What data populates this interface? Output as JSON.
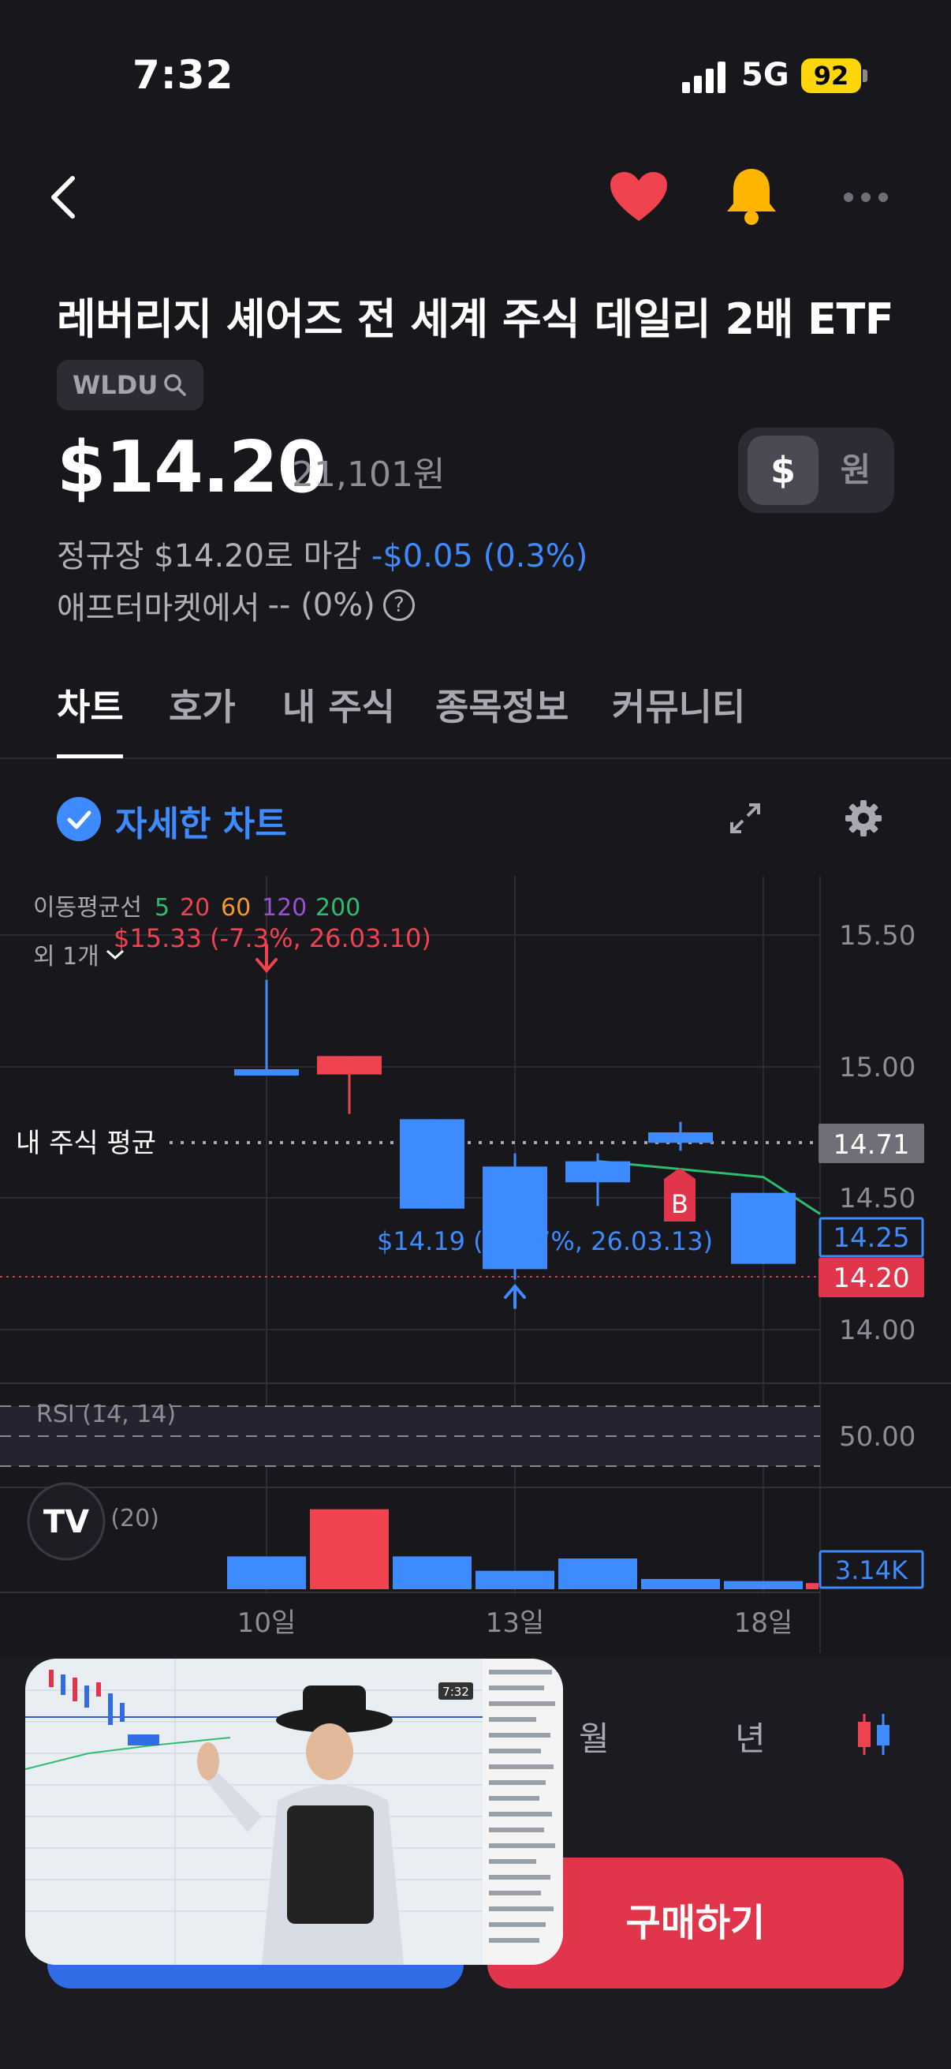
{
  "status_bar": {
    "time": "7:32",
    "network": "5G",
    "battery": "92"
  },
  "header": {
    "title": "레버리지 셰어즈 전 세계 주식 데일리 2배 ETF",
    "ticker": "WLDU"
  },
  "price": {
    "usd": "$14.20",
    "krw": "21,101원",
    "currency_usd": "$",
    "currency_krw": "원",
    "close_prefix": "정규장 $14.20로 마감",
    "close_change": "-$0.05 (0.3%)",
    "after_prefix": "애프터마켓에서",
    "after_change": "-- (0%)",
    "help_icon": "?"
  },
  "tabs": [
    "차트",
    "호가",
    "내 주식",
    "종목정보",
    "커뮤니티"
  ],
  "chart_toolbar": {
    "detail_label": "자세한 차트"
  },
  "chart_labels": {
    "ma_label": "이동평균선",
    "ma_periods": [
      "5",
      "20",
      "60",
      "120",
      "200"
    ],
    "ma_colors": [
      "#2dbd6e",
      "#f0424f",
      "#f59a23",
      "#9b4fd4",
      "#2dbd6e"
    ],
    "extra": "외 1개",
    "high_note": "$15.33 (-7.3%, 26.03.10)",
    "low_note_left": "$14.19 (",
    "low_note_right": "7%, 26.03.13)",
    "avg_label": "내 주식 평균",
    "avg_value": "14.71",
    "price_tag_blue": "14.25",
    "price_tag_red": "14.20",
    "buy_marker": "B",
    "rsi_label": "RSI (14, 14)",
    "rsi_value": "50.00",
    "volume_label": "거래량 (20)",
    "volume_value": "3.14K",
    "x_ticks": [
      "10일",
      "13일",
      "18일"
    ],
    "y_ticks": [
      "15.50",
      "15.00",
      "14.50",
      "14.00"
    ]
  },
  "chart_data": {
    "type": "candlestick",
    "y_range": [
      13.8,
      15.65
    ],
    "candles": [
      {
        "open": 14.99,
        "close": 14.98,
        "high": 15.33,
        "low": 14.98,
        "color": "blue"
      },
      {
        "open": 15.04,
        "close": 14.97,
        "high": 15.04,
        "low": 14.82,
        "color": "red"
      },
      {
        "open": 14.8,
        "close": 14.46,
        "high": 14.8,
        "low": 14.46,
        "color": "blue"
      },
      {
        "open": 14.62,
        "close": 14.23,
        "high": 14.67,
        "low": 14.19,
        "color": "blue"
      },
      {
        "open": 14.64,
        "close": 14.56,
        "high": 14.67,
        "low": 14.47,
        "color": "blue"
      },
      {
        "open": 14.75,
        "close": 14.71,
        "high": 14.79,
        "low": 14.68,
        "color": "blue"
      },
      {
        "open": 14.52,
        "close": 14.25,
        "high": 14.52,
        "low": 14.25,
        "color": "blue"
      }
    ],
    "ma5": [
      14.64,
      14.61,
      14.58,
      14.44
    ],
    "volume": [
      1.6,
      3.9,
      1.6,
      0.9,
      1.5,
      0.5,
      0.4,
      0.3
    ],
    "volume_colors": [
      "blue",
      "red",
      "blue",
      "blue",
      "blue",
      "blue",
      "blue",
      "red"
    ]
  },
  "period_tabs": [
    "월",
    "년"
  ],
  "buttons": {
    "buy": "구매하기"
  },
  "pip": {
    "overlay_time": "7:32"
  }
}
